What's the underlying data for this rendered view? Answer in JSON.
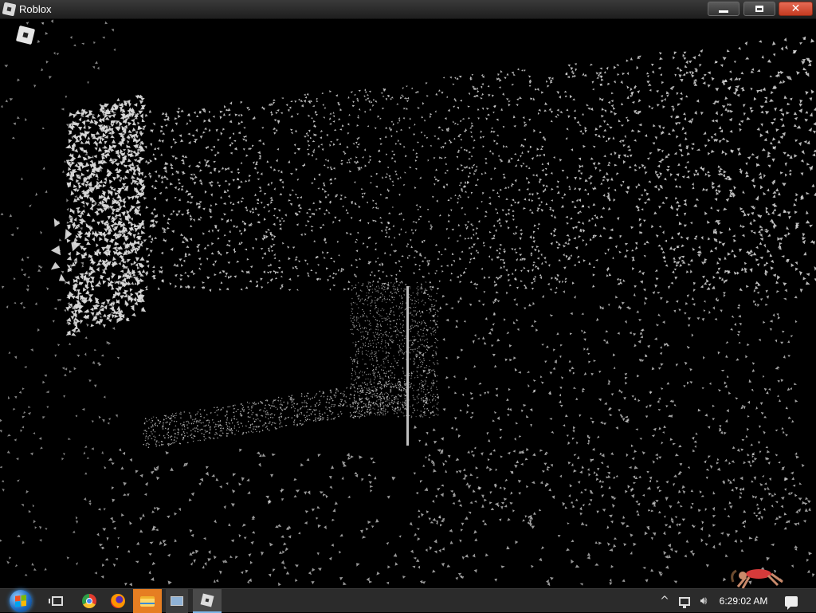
{
  "window": {
    "title": "Roblox"
  },
  "taskbar": {
    "clock": "6:29:02 AM",
    "apps": [
      "start-orb",
      "task-view",
      "chrome",
      "firefox",
      "file-explorer",
      "this-pc",
      "roblox"
    ]
  },
  "colors": {
    "scene_background": "#000000",
    "particle": "#d8d8d8",
    "taskbar": "#2b2b2b",
    "close_button": "#d4472c",
    "active_app": "#e67e22"
  },
  "icons": {
    "menu": "roblox-logo-icon",
    "close": "close-icon",
    "minimize": "minimize-icon",
    "maximize": "maximize-icon",
    "volume": "speaker-icon",
    "network": "network-icon",
    "notifications": "action-center-icon"
  }
}
